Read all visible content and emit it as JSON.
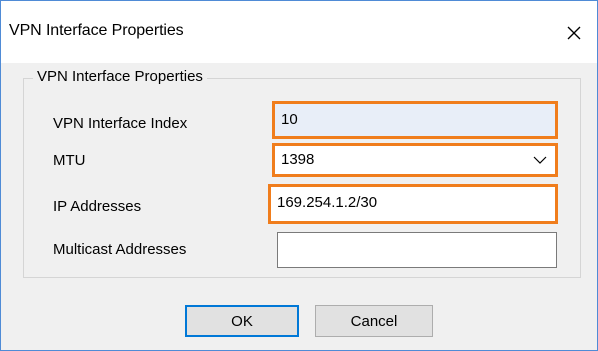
{
  "window": {
    "title": "VPN Interface Properties"
  },
  "group": {
    "legend": "VPN Interface Properties"
  },
  "fields": {
    "index": {
      "label": "VPN Interface Index",
      "value": "10"
    },
    "mtu": {
      "label": "MTU",
      "value": "1398"
    },
    "ip": {
      "label": "IP Addresses",
      "value": "169.254.1.2/30"
    },
    "multicast": {
      "label": "Multicast Addresses",
      "value": ""
    }
  },
  "buttons": {
    "ok": "OK",
    "cancel": "Cancel"
  },
  "icons": {
    "close": "close-icon",
    "dropdown": "chevron-down-icon"
  },
  "colors": {
    "highlight": "#f07d1c",
    "focus": "#0078d7",
    "window_border": "#4f8bd6"
  }
}
